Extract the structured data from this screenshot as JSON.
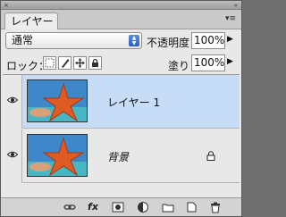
{
  "panel": {
    "tab_label": "レイヤー",
    "close_glyph": "×",
    "collapse_glyph": "«",
    "menu_glyph": "▾≡"
  },
  "blend": {
    "mode": "通常",
    "opacity_label": "不透明度：",
    "opacity_value": "100%"
  },
  "locks": {
    "label": "ロック：",
    "fill_label": "塗り：",
    "fill_value": "100%",
    "icons": [
      "lock-transparent-icon",
      "lock-paint-icon",
      "lock-move-icon",
      "lock-all-icon"
    ]
  },
  "layers": [
    {
      "name": "レイヤー 1",
      "selected": true,
      "italic": false,
      "locked": false
    },
    {
      "name": "背景",
      "selected": false,
      "italic": true,
      "locked": true
    }
  ],
  "toolbar": {
    "icons": [
      "link-layers-icon",
      "layer-style-fx-icon",
      "add-mask-icon",
      "adjustment-layer-icon",
      "new-group-icon",
      "new-layer-icon",
      "delete-layer-icon"
    ],
    "fx_label": "fx"
  }
}
